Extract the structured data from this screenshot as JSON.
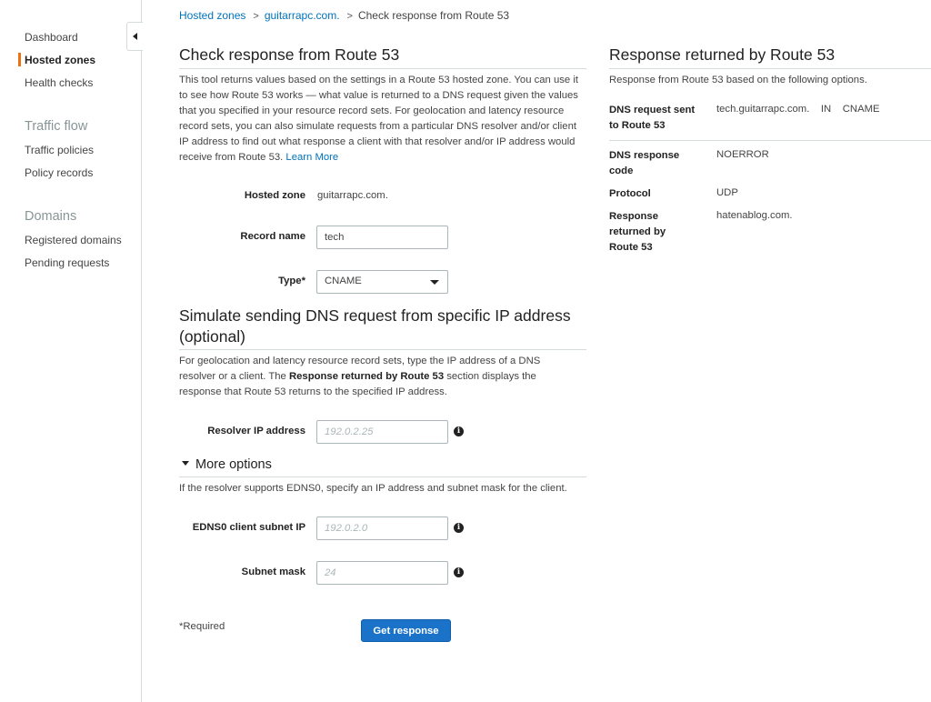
{
  "sidebar": {
    "items": [
      {
        "label": "Dashboard"
      },
      {
        "label": "Hosted zones"
      },
      {
        "label": "Health checks"
      }
    ],
    "traffic_flow": {
      "heading": "Traffic flow",
      "items": [
        {
          "label": "Traffic policies"
        },
        {
          "label": "Policy records"
        }
      ]
    },
    "domains": {
      "heading": "Domains",
      "items": [
        {
          "label": "Registered domains"
        },
        {
          "label": "Pending requests"
        }
      ]
    },
    "active_color": "#ec7211"
  },
  "breadcrumb": {
    "items": [
      "Hosted zones",
      "guitarrapc.com.",
      "Check response from Route 53"
    ],
    "separator": ">"
  },
  "check": {
    "title": "Check response from Route 53",
    "description": "This tool returns values based on the settings in a Route 53 hosted zone. You can use it to see how Route 53 works — what value is returned to a DNS request given the values that you specified in your resource record sets. For geolocation and latency resource record sets, you can also simulate requests from a particular DNS resolver and/or client IP address to find out what response a client with that resolver and/or IP address would receive from Route 53.",
    "learn_more": "Learn More",
    "hosted_zone_label": "Hosted zone",
    "hosted_zone_value": "guitarrapc.com.",
    "record_name_label": "Record name",
    "record_name_value": "tech",
    "type_label": "Type*",
    "type_value": "CNAME"
  },
  "simulate": {
    "title": "Simulate sending DNS request from specific IP address (optional)",
    "desc_part1": "For geolocation and latency resource record sets, type the IP address of a DNS resolver or a client. The ",
    "desc_bold": "Response returned by Route 53",
    "desc_part2": " section displays the response that Route 53 returns to the specified IP address.",
    "resolver_label": "Resolver IP address",
    "resolver_placeholder": "192.0.2.25",
    "info_glyph": "i"
  },
  "more_options": {
    "label": "More options",
    "description": "If the resolver supports EDNS0, specify an IP address and subnet mask for the client.",
    "edns_label": "EDNS0 client subnet IP",
    "edns_placeholder": "192.0.2.0",
    "mask_label": "Subnet mask",
    "mask_placeholder": "24"
  },
  "footer": {
    "required_note": "*Required",
    "submit_label": "Get response",
    "button_color": "#1a73c9"
  },
  "response": {
    "title": "Response returned by Route 53",
    "subtitle": "Response from Route 53 based on the following options.",
    "rows": [
      {
        "label": "DNS request sent to Route 53",
        "value": "tech.guitarrapc.com.    IN    CNAME"
      },
      {
        "label": "DNS response code",
        "value": "NOERROR"
      },
      {
        "label": "Protocol",
        "value": "UDP"
      },
      {
        "label": "Response returned by Route 53",
        "value": "hatenablog.com."
      }
    ]
  }
}
